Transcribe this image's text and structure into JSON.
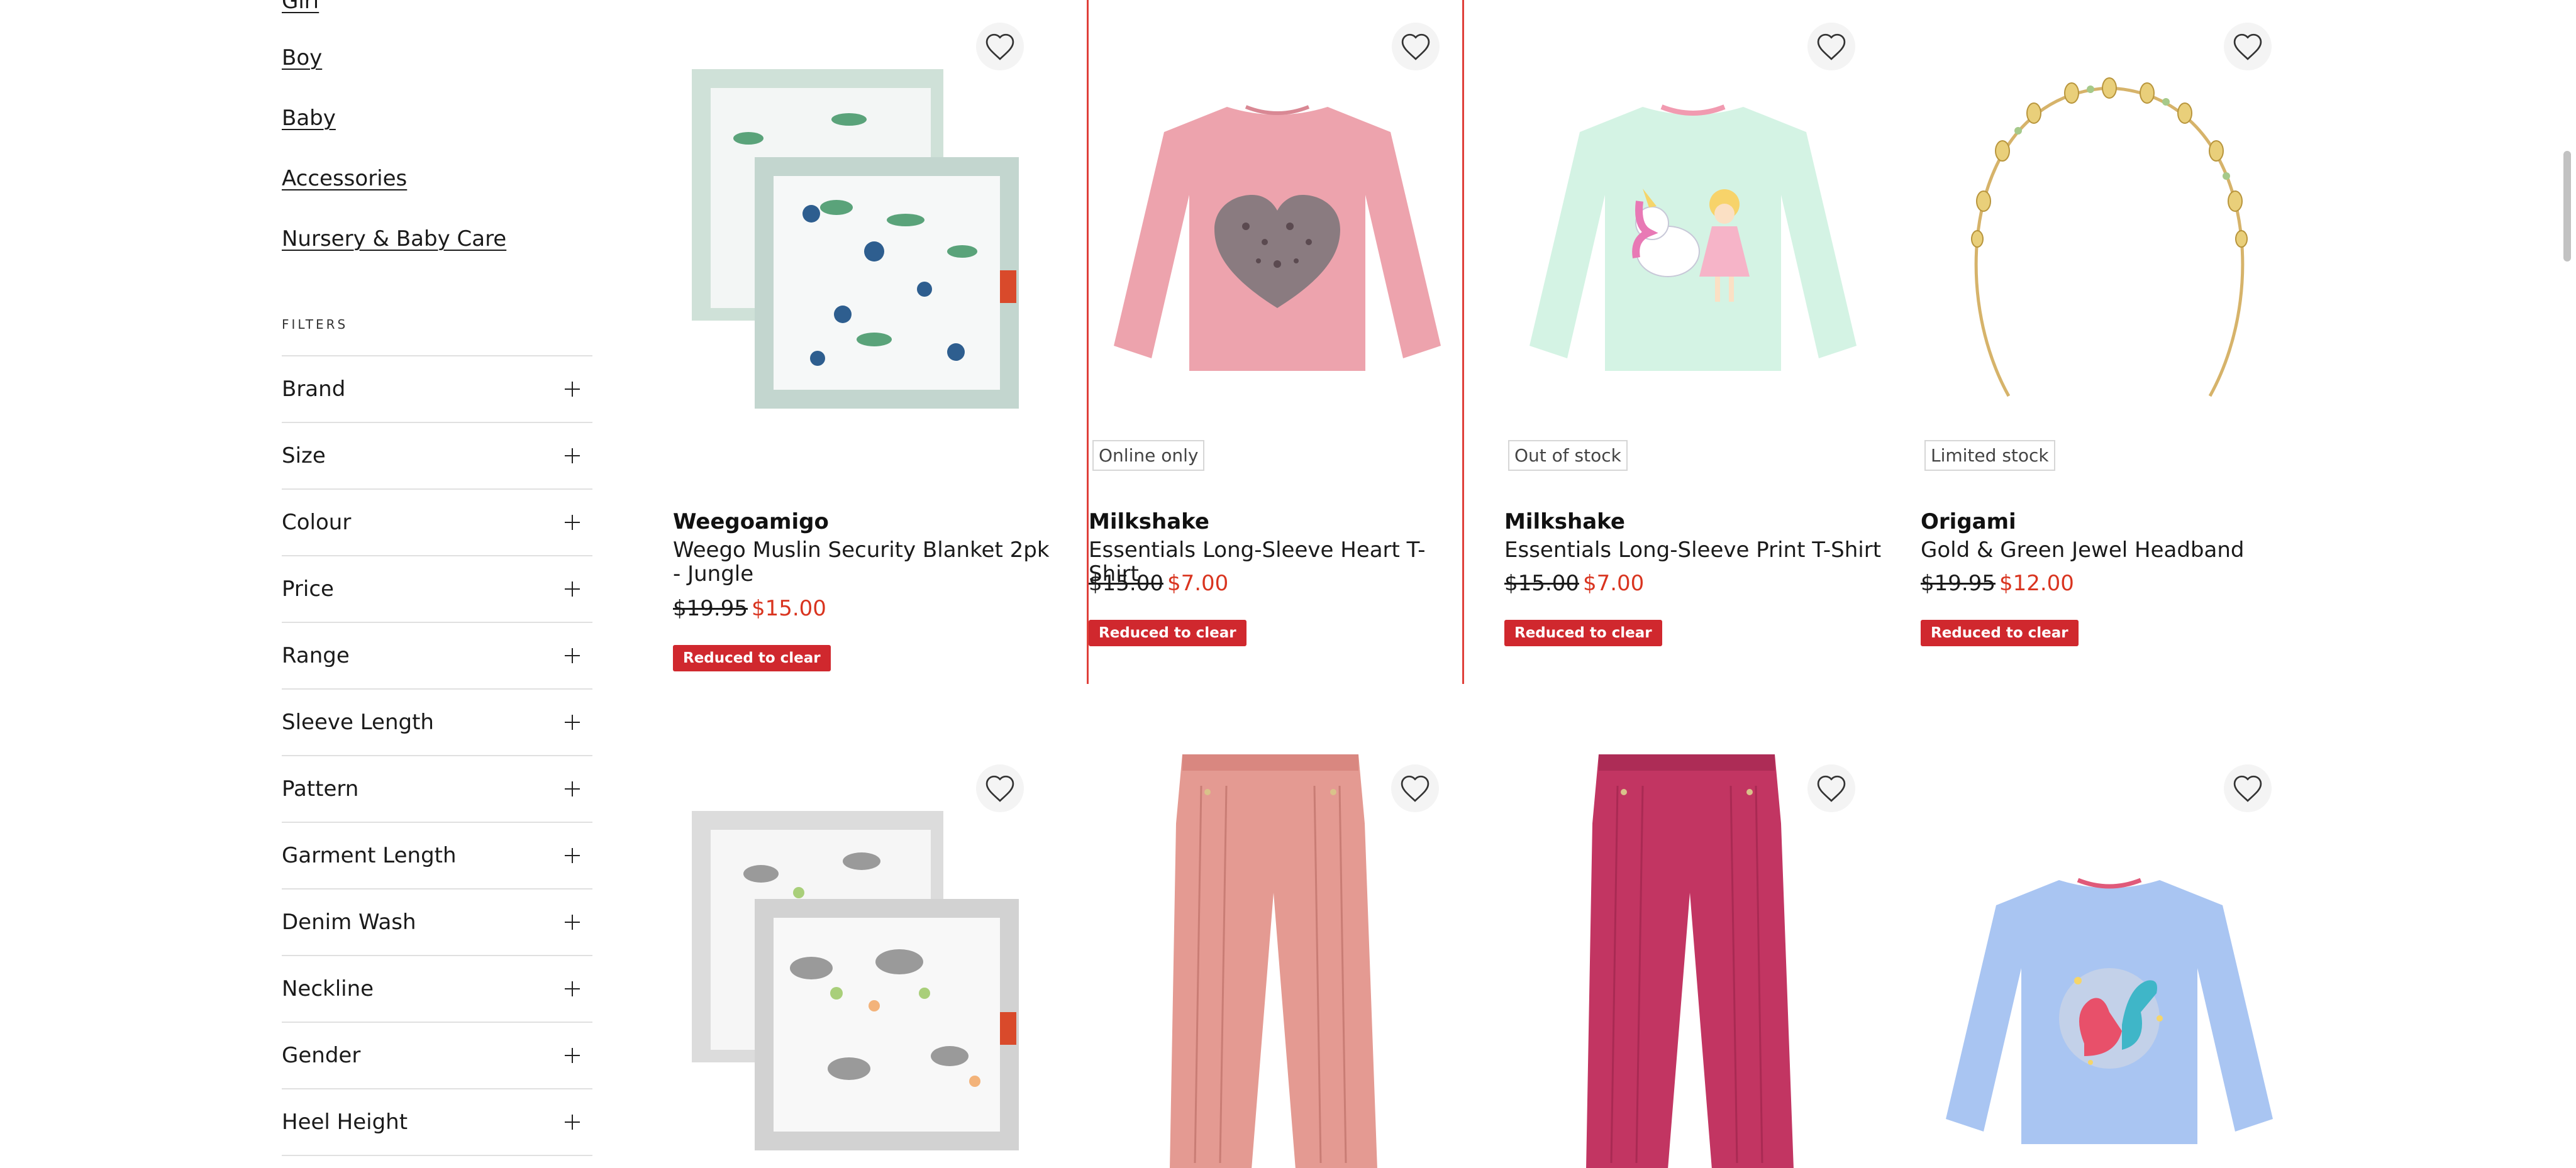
{
  "categories": [
    {
      "label": "Girl"
    },
    {
      "label": "Boy"
    },
    {
      "label": "Baby"
    },
    {
      "label": "Accessories"
    },
    {
      "label": "Nursery & Baby Care"
    }
  ],
  "filters": {
    "heading": "FILTERS",
    "items": [
      {
        "label": "Brand"
      },
      {
        "label": "Size"
      },
      {
        "label": "Colour"
      },
      {
        "label": "Price"
      },
      {
        "label": "Range"
      },
      {
        "label": "Sleeve Length"
      },
      {
        "label": "Pattern"
      },
      {
        "label": "Garment Length"
      },
      {
        "label": "Denim Wash"
      },
      {
        "label": "Neckline"
      },
      {
        "label": "Gender"
      },
      {
        "label": "Heel Height"
      }
    ]
  },
  "products": [
    {
      "brand": "Weegoamigo",
      "name": "Weego Muslin Security Blanket 2pk - Jungle",
      "was_price": "$19.95",
      "now_price": "$15.00",
      "tag": "Reduced to clear",
      "image_icon": "jungle-blanket-image"
    },
    {
      "badge": "Online only",
      "brand": "Milkshake",
      "name": "Essentials Long-Sleeve Heart T-Shirt",
      "was_price": "$15.00",
      "now_price": "$7.00",
      "tag": "Reduced to clear",
      "image_icon": "pink-heart-tshirt-image"
    },
    {
      "badge": "Out of stock",
      "brand": "Milkshake",
      "name": "Essentials Long-Sleeve Print T-Shirt",
      "was_price": "$15.00",
      "now_price": "$7.00",
      "tag": "Reduced to clear",
      "image_icon": "mint-unicorn-tshirt-image"
    },
    {
      "badge": "Limited stock",
      "brand": "Origami",
      "name": "Gold & Green Jewel Headband",
      "was_price": "$19.95",
      "now_price": "$12.00",
      "tag": "Reduced to clear",
      "image_icon": "jewel-headband-image"
    },
    {
      "image_icon": "animal-blanket-image"
    },
    {
      "image_icon": "pink-cord-pants-image"
    },
    {
      "image_icon": "raspberry-cord-pants-image"
    },
    {
      "image_icon": "blue-dinosaur-tshirt-image"
    }
  ],
  "colors": {
    "sale_price": "#d9341f",
    "tag_background": "#d0282e",
    "selected_outline": "#e0403a"
  }
}
